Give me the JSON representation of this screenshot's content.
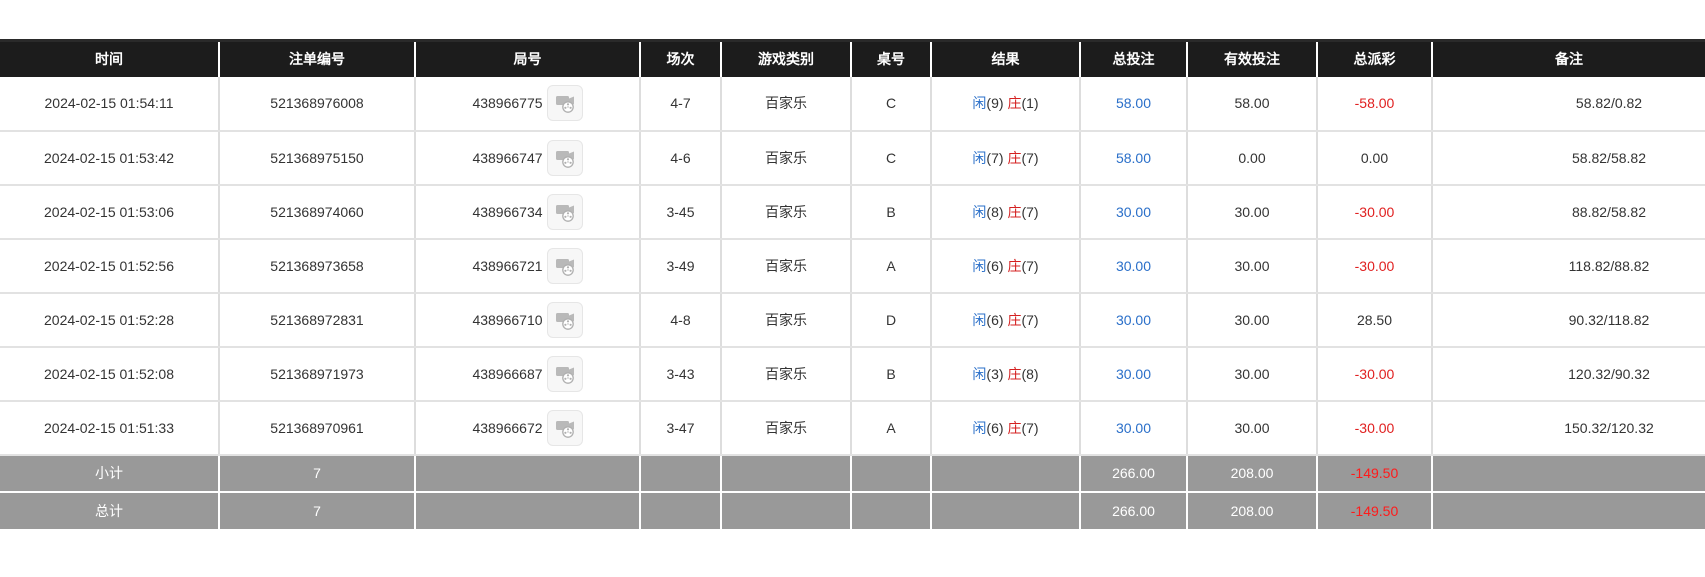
{
  "columns": [
    "时间",
    "注单编号",
    "局号",
    "场次",
    "游戏类别",
    "桌号",
    "结果",
    "总投注",
    "有效投注",
    "总派彩",
    "备注"
  ],
  "rows": [
    {
      "time": "2024-02-15 01:54:11",
      "order_id": "521368976008",
      "round_id": "438966775",
      "session": "4-7",
      "game_type": "百家乐",
      "table": "C",
      "player_label": "闲",
      "player_score": "(9)",
      "banker_label": "庄",
      "banker_score": "(1)",
      "total_bet": "58.00",
      "valid_bet": "58.00",
      "payout": "-58.00",
      "payout_color": "red",
      "note": "58.82/0.82"
    },
    {
      "time": "2024-02-15 01:53:42",
      "order_id": "521368975150",
      "round_id": "438966747",
      "session": "4-6",
      "game_type": "百家乐",
      "table": "C",
      "player_label": "闲",
      "player_score": "(7)",
      "banker_label": "庄",
      "banker_score": "(7)",
      "total_bet": "58.00",
      "valid_bet": "0.00",
      "payout": "0.00",
      "payout_color": "normal",
      "note": "58.82/58.82"
    },
    {
      "time": "2024-02-15 01:53:06",
      "order_id": "521368974060",
      "round_id": "438966734",
      "session": "3-45",
      "game_type": "百家乐",
      "table": "B",
      "player_label": "闲",
      "player_score": "(8)",
      "banker_label": "庄",
      "banker_score": "(7)",
      "total_bet": "30.00",
      "valid_bet": "30.00",
      "payout": "-30.00",
      "payout_color": "red",
      "note": "88.82/58.82"
    },
    {
      "time": "2024-02-15 01:52:56",
      "order_id": "521368973658",
      "round_id": "438966721",
      "session": "3-49",
      "game_type": "百家乐",
      "table": "A",
      "player_label": "闲",
      "player_score": "(6)",
      "banker_label": "庄",
      "banker_score": "(7)",
      "total_bet": "30.00",
      "valid_bet": "30.00",
      "payout": "-30.00",
      "payout_color": "red",
      "note": "118.82/88.82"
    },
    {
      "time": "2024-02-15 01:52:28",
      "order_id": "521368972831",
      "round_id": "438966710",
      "session": "4-8",
      "game_type": "百家乐",
      "table": "D",
      "player_label": "闲",
      "player_score": "(6)",
      "banker_label": "庄",
      "banker_score": "(7)",
      "total_bet": "30.00",
      "valid_bet": "30.00",
      "payout": "28.50",
      "payout_color": "normal",
      "note": "90.32/118.82"
    },
    {
      "time": "2024-02-15 01:52:08",
      "order_id": "521368971973",
      "round_id": "438966687",
      "session": "3-43",
      "game_type": "百家乐",
      "table": "B",
      "player_label": "闲",
      "player_score": "(3)",
      "banker_label": "庄",
      "banker_score": "(8)",
      "total_bet": "30.00",
      "valid_bet": "30.00",
      "payout": "-30.00",
      "payout_color": "red",
      "note": "120.32/90.32"
    },
    {
      "time": "2024-02-15 01:51:33",
      "order_id": "521368970961",
      "round_id": "438966672",
      "session": "3-47",
      "game_type": "百家乐",
      "table": "A",
      "player_label": "闲",
      "player_score": "(6)",
      "banker_label": "庄",
      "banker_score": "(7)",
      "total_bet": "30.00",
      "valid_bet": "30.00",
      "payout": "-30.00",
      "payout_color": "red",
      "note": "150.32/120.32"
    }
  ],
  "subtotal": {
    "label": "小计",
    "count": "7",
    "total_bet": "266.00",
    "valid_bet": "208.00",
    "payout": "-149.50"
  },
  "total": {
    "label": "总计",
    "count": "7",
    "total_bet": "266.00",
    "valid_bet": "208.00",
    "payout": "-149.50"
  },
  "icons": {
    "replay": "video-replay-icon"
  },
  "colors": {
    "header_bg": "#1c1c1c",
    "footer_bg": "#999999",
    "player": "#2a6fc9",
    "banker": "#d42020",
    "negative": "#e02020"
  }
}
